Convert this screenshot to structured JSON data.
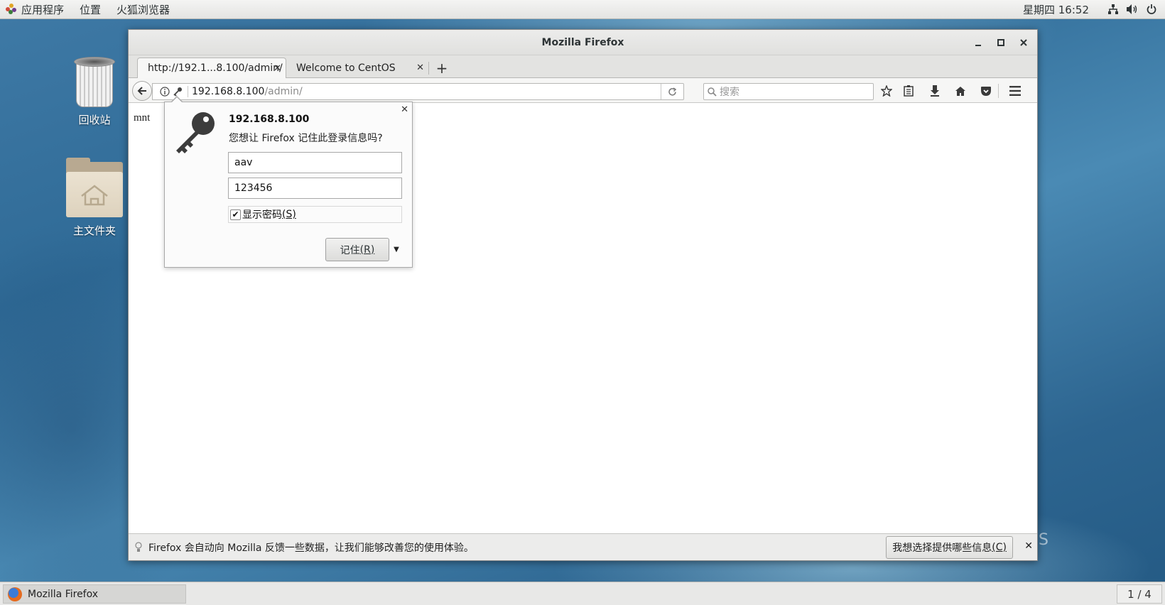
{
  "topbar": {
    "apps_label": "应用程序",
    "places_label": "位置",
    "browser_label": "火狐浏览器",
    "clock": "星期四 16:52"
  },
  "desktop": {
    "trash_label": "回收站",
    "home_label": "主文件夹"
  },
  "window": {
    "title": "Mozilla Firefox",
    "tabs": [
      {
        "label": "http://192.1...8.100/admin/"
      },
      {
        "label": "Welcome to CentOS"
      }
    ],
    "url_host": "192.168.8.100",
    "url_path": "/admin/",
    "search_placeholder": "搜索"
  },
  "page": {
    "text": "mnt"
  },
  "doorhanger": {
    "host": "192.168.8.100",
    "message": "您想让 Firefox 记住此登录信息吗?",
    "username": "aav",
    "password": "123456",
    "show_password_label": "显示密码",
    "show_password_key": "(S)",
    "show_password_checked": true,
    "remember_label": "记住",
    "remember_key": "(R)"
  },
  "notification": {
    "message": "Firefox 会自动向 Mozilla 反馈一些数据，让我们能够改善您的使用体验。",
    "button_label": "我想选择提供哪些信息",
    "button_key": "(C)"
  },
  "taskbar": {
    "window_label": "Mozilla Firefox",
    "workspace": "1 / 4"
  },
  "colors": {
    "desktop_blue": "#2f6a96",
    "panel": "#e8e8e7"
  }
}
